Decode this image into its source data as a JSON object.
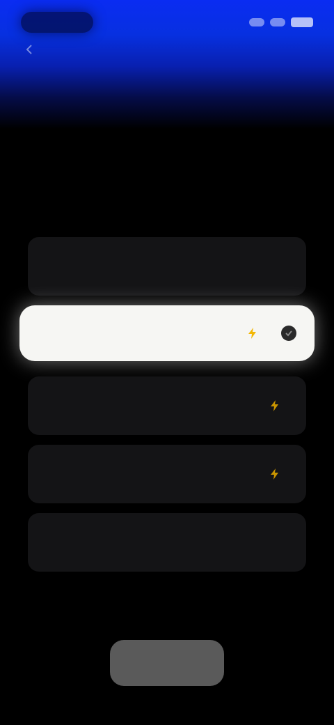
{
  "status_bar": {
    "time": "",
    "icons": [
      "signal-icon",
      "wifi-icon",
      "battery-icon"
    ]
  },
  "header": {
    "title": "",
    "subtitle": ""
  },
  "options": [
    {
      "label": "",
      "detail": "",
      "selected": false,
      "bolt": false
    },
    {
      "label": "",
      "detail": "",
      "selected": true,
      "bolt": true
    },
    {
      "label": "",
      "detail": "",
      "selected": false,
      "bolt": true
    },
    {
      "label": "",
      "detail": "",
      "selected": false,
      "bolt": true
    },
    {
      "label": "",
      "detail": "",
      "selected": false,
      "bolt": false
    }
  ],
  "continue_button": {
    "label": ""
  },
  "colors": {
    "accent_blue": "#0a2cf2",
    "background": "#000000",
    "card": "#141416",
    "selected_card": "#f6f6f3",
    "bolt": "#f2b705",
    "button": "#5a5a5a"
  }
}
